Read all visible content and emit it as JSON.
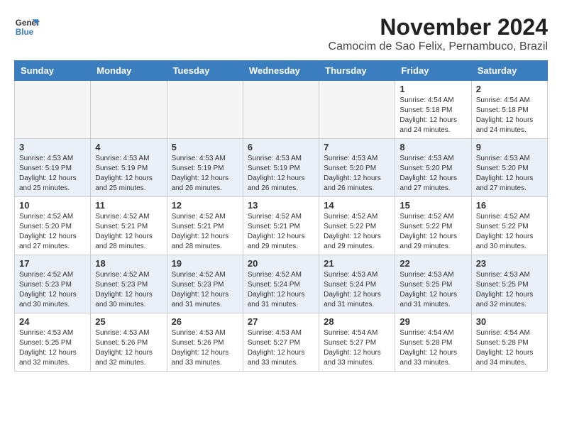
{
  "logo": {
    "line1": "General",
    "line2": "Blue"
  },
  "title": "November 2024",
  "location": "Camocim de Sao Felix, Pernambuco, Brazil",
  "weekdays": [
    "Sunday",
    "Monday",
    "Tuesday",
    "Wednesday",
    "Thursday",
    "Friday",
    "Saturday"
  ],
  "weeks": [
    [
      {
        "day": "",
        "info": ""
      },
      {
        "day": "",
        "info": ""
      },
      {
        "day": "",
        "info": ""
      },
      {
        "day": "",
        "info": ""
      },
      {
        "day": "",
        "info": ""
      },
      {
        "day": "1",
        "info": "Sunrise: 4:54 AM\nSunset: 5:18 PM\nDaylight: 12 hours\nand 24 minutes."
      },
      {
        "day": "2",
        "info": "Sunrise: 4:54 AM\nSunset: 5:18 PM\nDaylight: 12 hours\nand 24 minutes."
      }
    ],
    [
      {
        "day": "3",
        "info": "Sunrise: 4:53 AM\nSunset: 5:19 PM\nDaylight: 12 hours\nand 25 minutes."
      },
      {
        "day": "4",
        "info": "Sunrise: 4:53 AM\nSunset: 5:19 PM\nDaylight: 12 hours\nand 25 minutes."
      },
      {
        "day": "5",
        "info": "Sunrise: 4:53 AM\nSunset: 5:19 PM\nDaylight: 12 hours\nand 26 minutes."
      },
      {
        "day": "6",
        "info": "Sunrise: 4:53 AM\nSunset: 5:19 PM\nDaylight: 12 hours\nand 26 minutes."
      },
      {
        "day": "7",
        "info": "Sunrise: 4:53 AM\nSunset: 5:20 PM\nDaylight: 12 hours\nand 26 minutes."
      },
      {
        "day": "8",
        "info": "Sunrise: 4:53 AM\nSunset: 5:20 PM\nDaylight: 12 hours\nand 27 minutes."
      },
      {
        "day": "9",
        "info": "Sunrise: 4:53 AM\nSunset: 5:20 PM\nDaylight: 12 hours\nand 27 minutes."
      }
    ],
    [
      {
        "day": "10",
        "info": "Sunrise: 4:52 AM\nSunset: 5:20 PM\nDaylight: 12 hours\nand 27 minutes."
      },
      {
        "day": "11",
        "info": "Sunrise: 4:52 AM\nSunset: 5:21 PM\nDaylight: 12 hours\nand 28 minutes."
      },
      {
        "day": "12",
        "info": "Sunrise: 4:52 AM\nSunset: 5:21 PM\nDaylight: 12 hours\nand 28 minutes."
      },
      {
        "day": "13",
        "info": "Sunrise: 4:52 AM\nSunset: 5:21 PM\nDaylight: 12 hours\nand 29 minutes."
      },
      {
        "day": "14",
        "info": "Sunrise: 4:52 AM\nSunset: 5:22 PM\nDaylight: 12 hours\nand 29 minutes."
      },
      {
        "day": "15",
        "info": "Sunrise: 4:52 AM\nSunset: 5:22 PM\nDaylight: 12 hours\nand 29 minutes."
      },
      {
        "day": "16",
        "info": "Sunrise: 4:52 AM\nSunset: 5:22 PM\nDaylight: 12 hours\nand 30 minutes."
      }
    ],
    [
      {
        "day": "17",
        "info": "Sunrise: 4:52 AM\nSunset: 5:23 PM\nDaylight: 12 hours\nand 30 minutes."
      },
      {
        "day": "18",
        "info": "Sunrise: 4:52 AM\nSunset: 5:23 PM\nDaylight: 12 hours\nand 30 minutes."
      },
      {
        "day": "19",
        "info": "Sunrise: 4:52 AM\nSunset: 5:23 PM\nDaylight: 12 hours\nand 31 minutes."
      },
      {
        "day": "20",
        "info": "Sunrise: 4:52 AM\nSunset: 5:24 PM\nDaylight: 12 hours\nand 31 minutes."
      },
      {
        "day": "21",
        "info": "Sunrise: 4:53 AM\nSunset: 5:24 PM\nDaylight: 12 hours\nand 31 minutes."
      },
      {
        "day": "22",
        "info": "Sunrise: 4:53 AM\nSunset: 5:25 PM\nDaylight: 12 hours\nand 31 minutes."
      },
      {
        "day": "23",
        "info": "Sunrise: 4:53 AM\nSunset: 5:25 PM\nDaylight: 12 hours\nand 32 minutes."
      }
    ],
    [
      {
        "day": "24",
        "info": "Sunrise: 4:53 AM\nSunset: 5:25 PM\nDaylight: 12 hours\nand 32 minutes."
      },
      {
        "day": "25",
        "info": "Sunrise: 4:53 AM\nSunset: 5:26 PM\nDaylight: 12 hours\nand 32 minutes."
      },
      {
        "day": "26",
        "info": "Sunrise: 4:53 AM\nSunset: 5:26 PM\nDaylight: 12 hours\nand 33 minutes."
      },
      {
        "day": "27",
        "info": "Sunrise: 4:53 AM\nSunset: 5:27 PM\nDaylight: 12 hours\nand 33 minutes."
      },
      {
        "day": "28",
        "info": "Sunrise: 4:54 AM\nSunset: 5:27 PM\nDaylight: 12 hours\nand 33 minutes."
      },
      {
        "day": "29",
        "info": "Sunrise: 4:54 AM\nSunset: 5:28 PM\nDaylight: 12 hours\nand 33 minutes."
      },
      {
        "day": "30",
        "info": "Sunrise: 4:54 AM\nSunset: 5:28 PM\nDaylight: 12 hours\nand 34 minutes."
      }
    ]
  ]
}
